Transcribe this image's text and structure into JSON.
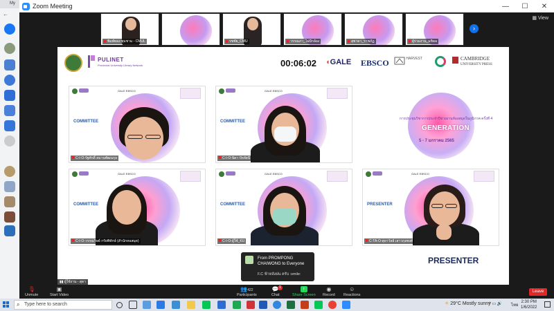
{
  "window": {
    "title": "Zoom Meeting",
    "minimize": "—",
    "maximize": "☐",
    "close": "✕"
  },
  "browser": {
    "tab_label": "My"
  },
  "gallery": {
    "view_label": "View",
    "thumbs": [
      {
        "name": "พิมพ์ทอง ชุมชาม - CMUL",
        "type": "person"
      },
      {
        "name": "",
        "type": "slide"
      },
      {
        "name": "รชชัย_CMU",
        "type": "person"
      },
      {
        "name": "วรรณภา_ไม่มีกล้อง",
        "type": "slide"
      },
      {
        "name": "สุชาดา_ราชภัฏ",
        "type": "slide"
      },
      {
        "name": "ผู้ร่วมงาน_มหิดล",
        "type": "slide"
      }
    ]
  },
  "share": {
    "timer": "00:06:02",
    "pulinet": "PULINET",
    "pulinet_sub": "Provincial University Library Network",
    "sponsors": {
      "gale": "GALE",
      "ebsco": "EBSCO",
      "harvest": "HARVEST",
      "cambridge_line1": "CAMBRIDGE",
      "cambridge_line2": "UNIVERSITY PRESS"
    },
    "tiles": [
      {
        "role": "COMMITTEE",
        "name": "C-I-O-รัฐศักดิ์ สมานพัฒนกุล"
      },
      {
        "role": "COMMITTEE",
        "name": "C-I-O-นิดา ปัจจัยนี"
      },
      {
        "role": "COMMITTEE",
        "name": "C-I-O-วรรณวิษย์ กรัยพิทักษ์ (สำนักหอสมุด)"
      },
      {
        "role": "COMMITTEE",
        "name": "C-I-O-ผู้ใช้_KU"
      },
      {
        "role": "PRESENTER",
        "name": "C-TA-O-สุดาวัลย์ เสาวกุลพงศ์"
      }
    ],
    "promo": {
      "line1": "การประชุมวิชาการประจำปีข่ายงานห้องสมุดในภูมิภาค ครั้งที่ 4",
      "generation": "GENERATION",
      "date": "5 - 7 มกราคม 2565"
    },
    "presenter_label": "PRESENTER",
    "mic_status": "ผู้ใช้งาน - สุดา"
  },
  "chat_popup": {
    "from": "From PROMPONG CHAIWONG to Everyone",
    "message": "F.C ฟ้าหลังฝน ครับ :smile:"
  },
  "toolbar": {
    "unmute": "Unmute",
    "start_video": "Start Video",
    "participants": "Participants",
    "participants_count": "422",
    "chat": "Chat",
    "chat_badge": "1",
    "share_screen": "Share Screen",
    "record": "Record",
    "reactions": "Reactions",
    "leave": "Leave"
  },
  "taskbar": {
    "search_placeholder": "Type here to search",
    "weather": "29°C  Mostly sunny",
    "lang": "ไทย",
    "time": "2:30 PM",
    "date": "1/6/2022"
  }
}
